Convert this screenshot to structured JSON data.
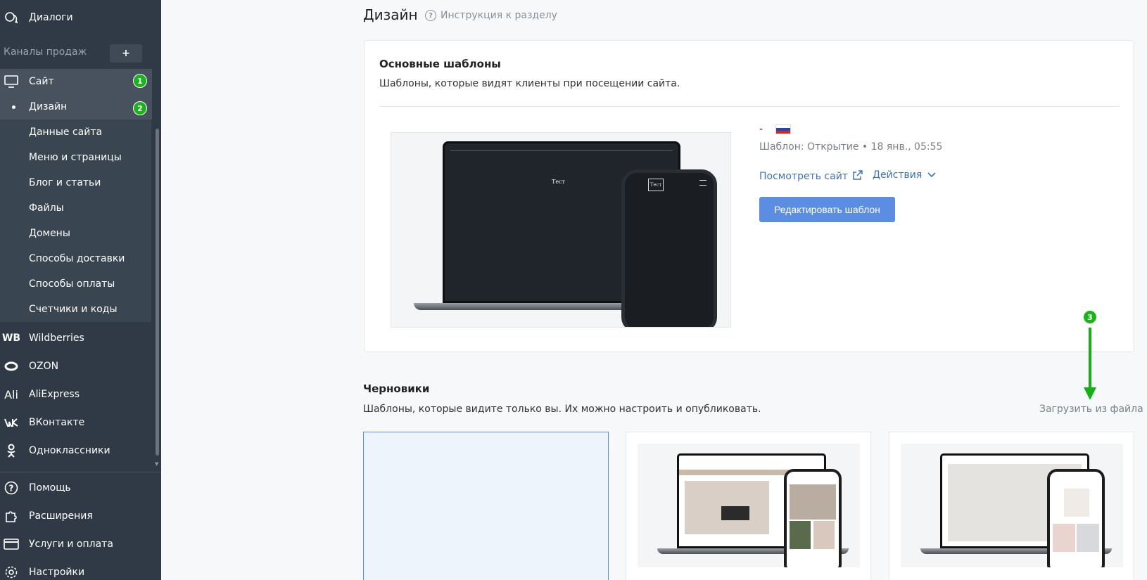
{
  "sidebar": {
    "dialogs": "Диалоги",
    "sales_channels": "Каналы продаж",
    "add_label": "+",
    "site": {
      "label": "Сайт",
      "badge": "1"
    },
    "site_items": [
      {
        "label": "Дизайн",
        "badge": "2",
        "active": true
      },
      {
        "label": "Данные сайта"
      },
      {
        "label": "Меню и страницы"
      },
      {
        "label": "Блог и статьи"
      },
      {
        "label": "Файлы"
      },
      {
        "label": "Домены"
      },
      {
        "label": "Способы доставки"
      },
      {
        "label": "Способы оплаты"
      },
      {
        "label": "Счетчики и коды"
      }
    ],
    "channels": [
      {
        "label": "Wildberries",
        "icon": "WB"
      },
      {
        "label": "OZON",
        "icon": "ozon-icon"
      },
      {
        "label": "AliExpress",
        "icon": "Ali"
      },
      {
        "label": "ВКонтакте",
        "icon": "vk-icon"
      },
      {
        "label": "Одноклассники",
        "icon": "ok-icon"
      }
    ],
    "bottom": [
      {
        "label": "Помощь",
        "icon": "help-icon"
      },
      {
        "label": "Расширения",
        "icon": "puzzle-icon"
      },
      {
        "label": "Услуги и оплата",
        "icon": "card-icon"
      },
      {
        "label": "Настройки",
        "icon": "gear-icon"
      }
    ]
  },
  "header": {
    "title": "Дизайн",
    "help": "Инструкция к разделу"
  },
  "main_templates": {
    "title": "Основные шаблоны",
    "subtitle": "Шаблоны, которые видят клиенты при посещении сайта.",
    "lang_dash": "-",
    "meta": "Шаблон: Открытие • 18 янв., 05:55",
    "view_site": "Посмотреть сайт",
    "actions": "Действия",
    "edit": "Редактировать шаблон",
    "preview_logo": "Тест"
  },
  "drafts": {
    "title": "Черновики",
    "subtitle": "Шаблоны, которые видите только вы. Их можно настроить и опубликовать.",
    "upload": "Загрузить из файла",
    "marker": "3"
  },
  "colors": {
    "sidebar": "#2f3a46",
    "accent": "#5b8de2",
    "link": "#3c6fbf",
    "badge": "#1bb31b"
  }
}
